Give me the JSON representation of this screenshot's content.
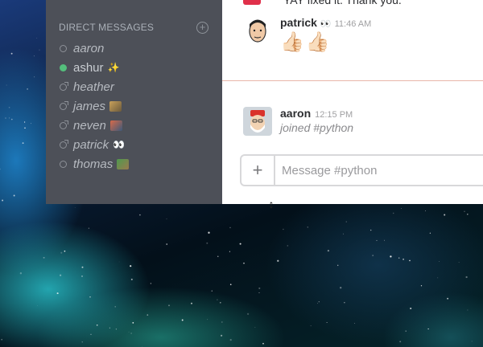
{
  "sidebar": {
    "dm_title": "DIRECT MESSAGES",
    "add_icon": "plus-circle-icon",
    "items": [
      {
        "name": "aaron",
        "status": "away",
        "emoji": ""
      },
      {
        "name": "ashur",
        "status": "active",
        "emoji": "✨"
      },
      {
        "name": "heather",
        "status": "dnd",
        "emoji": ""
      },
      {
        "name": "james",
        "status": "dnd",
        "emoji": "custom-image"
      },
      {
        "name": "neven",
        "status": "dnd",
        "emoji": "custom-image"
      },
      {
        "name": "patrick",
        "status": "dnd",
        "emoji": "👀"
      },
      {
        "name": "thomas",
        "status": "away",
        "emoji": "custom-image"
      }
    ]
  },
  "messages": {
    "previous_text": "YAY fixed it. Thank you.",
    "items": [
      {
        "author": "patrick",
        "author_emoji": "👀",
        "time": "11:46 AM",
        "content": "👍🏻👍🏻"
      },
      {
        "author": "aaron",
        "author_emoji": "",
        "time": "12:15 PM",
        "content": "joined #python"
      }
    ]
  },
  "composer": {
    "plus_label": "+",
    "placeholder": "Message #python"
  },
  "cursor": {
    "label": "↕"
  },
  "colors": {
    "sidebar_bg": "#4d5058",
    "active_presence": "#54bf7c",
    "new_divider": "#e8b6aa"
  }
}
